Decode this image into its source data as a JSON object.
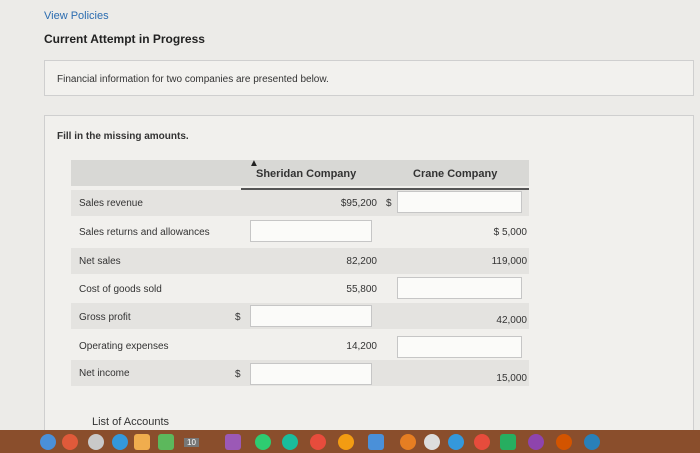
{
  "nav": {
    "view_policies": "View Policies"
  },
  "attempt": {
    "title": "Current Attempt in Progress"
  },
  "intro": {
    "text": "Financial information for two companies are presented below."
  },
  "exercise": {
    "instruction": "Fill in the missing amounts.",
    "columns": {
      "sheridan": "Sheridan Company",
      "crane": "Crane Company"
    },
    "rows": [
      {
        "label": "Sales revenue",
        "sheridan_prefix": "",
        "sheridan": "$95,200",
        "crane_prefix": "$",
        "crane": ""
      },
      {
        "label": "Sales returns and allowances",
        "sheridan": "",
        "crane": "$ 5,000"
      },
      {
        "label": "Net sales",
        "sheridan": "82,200",
        "crane": "119,000"
      },
      {
        "label": "Cost of goods sold",
        "sheridan": "55,800",
        "crane": ""
      },
      {
        "label": "Gross profit",
        "sheridan_prefix": "$",
        "sheridan": "",
        "crane": "42,000"
      },
      {
        "label": "Operating expenses",
        "sheridan": "14,200",
        "crane": ""
      },
      {
        "label": "Net income",
        "sheridan_prefix": "$",
        "sheridan": "",
        "crane": "15,000"
      }
    ],
    "list_accounts": "List of Accounts"
  },
  "taskbar": {
    "calendar_badge": "10",
    "colors": {
      "bar": "#8a4e2c",
      "icons": [
        "#4a90d9",
        "#e05a3a",
        "#5cb85c",
        "#f0ad4e",
        "#9b59b6",
        "#2ecc71",
        "#3498db",
        "#e74c3c",
        "#1abc9c",
        "#f39c12"
      ]
    }
  }
}
